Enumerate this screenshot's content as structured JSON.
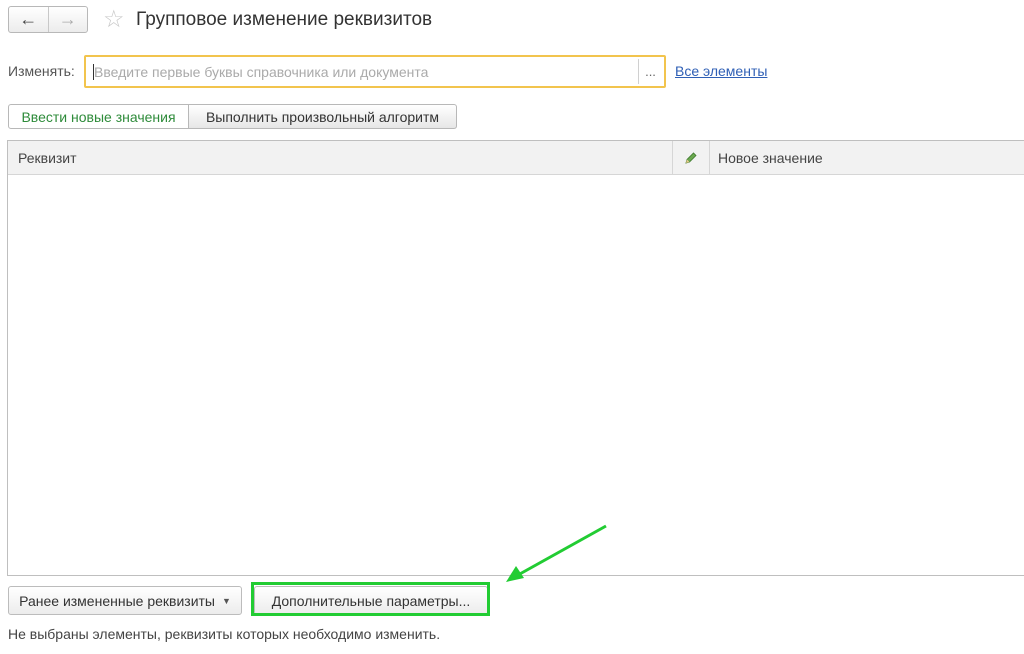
{
  "header": {
    "title": "Групповое изменение реквизитов",
    "back_icon": "←",
    "forward_icon": "→",
    "star_icon": "☆"
  },
  "change": {
    "label": "Изменять:",
    "placeholder": "Введите первые буквы справочника или документа",
    "value": "",
    "select_button": "...",
    "all_elements_link": "Все элементы"
  },
  "tabs": [
    {
      "label": "Ввести новые значения",
      "active": true
    },
    {
      "label": "Выполнить произвольный алгоритм",
      "active": false
    }
  ],
  "table": {
    "columns": [
      "Реквизит",
      "",
      "Новое значение"
    ],
    "rows": []
  },
  "footer": {
    "previous_button": "Ранее измененные реквизиты",
    "extra_button": "Дополнительные параметры...",
    "status": "Не выбраны элементы, реквизиты которых необходимо изменить."
  },
  "colors": {
    "accent_green": "#2e8b3a",
    "highlight": "#22cc33",
    "field_border": "#f2c44d",
    "link": "#2f5fb5"
  }
}
